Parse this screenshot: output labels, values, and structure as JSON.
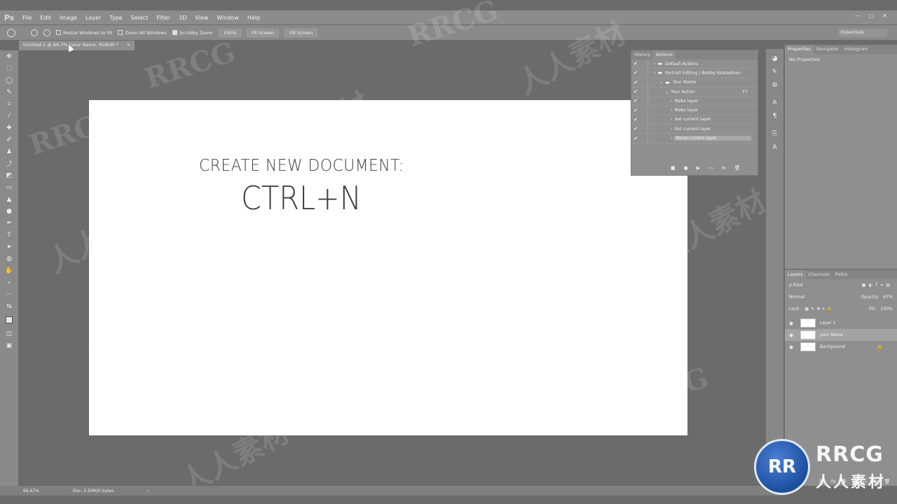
{
  "app": {
    "logo_text": "Ps",
    "menu": [
      "File",
      "Edit",
      "Image",
      "Layer",
      "Type",
      "Select",
      "Filter",
      "3D",
      "View",
      "Window",
      "Help"
    ],
    "window_controls": [
      "—",
      "▢",
      "✕"
    ]
  },
  "options_bar": {
    "resize_windows": "Resize Windows to Fit",
    "zoom_all": "Zoom All Windows",
    "scrubby_zoom": "Scrubby Zoom",
    "btn_100": "100%",
    "btn_fit": "Fit Screen",
    "btn_fill": "Fill Screen",
    "workspace": "Essentials"
  },
  "document": {
    "tab_title": "Untitled-1 @ 66,7% (your Name, RGB/8) *",
    "tab_close": "×",
    "headline": "CREATE NEW DOCUMENT:",
    "shortcut": "CTRL+N"
  },
  "actions_panel": {
    "tabs": [
      "History",
      "Actions"
    ],
    "rows": [
      {
        "label": "Default Actions",
        "indent": 0
      },
      {
        "label": "Portrait Editing | Bobby Kostadinov",
        "indent": 0
      },
      {
        "label": "Your Name",
        "indent": 1
      },
      {
        "label": "Your Action",
        "indent": 2,
        "fkey": "F7"
      },
      {
        "label": "Make layer",
        "indent": 3
      },
      {
        "label": "Make layer",
        "indent": 3
      },
      {
        "label": "Set current layer",
        "indent": 3
      },
      {
        "label": "Set current layer",
        "indent": 3
      },
      {
        "label": "Move current layer",
        "indent": 3,
        "selected": true
      }
    ],
    "footer_icons": [
      "■",
      "●",
      "▶",
      "▭",
      "⊕",
      "🗑"
    ]
  },
  "properties_panel": {
    "tabs": [
      "Properties",
      "Navigator",
      "Histogram"
    ],
    "content": "No Properties"
  },
  "layers_panel": {
    "tabs": [
      "Layers",
      "Channels",
      "Paths"
    ],
    "filter_label": "ρ Kind",
    "blend_mode": "Normal",
    "opacity_label": "Opacity:",
    "opacity_value": "67%",
    "lock_label": "Lock:",
    "fill_label": "Fill:",
    "fill_value": "100%",
    "layers": [
      {
        "name": "Layer 1",
        "selected": false,
        "locked": false
      },
      {
        "name": "your Name",
        "selected": true,
        "locked": false
      },
      {
        "name": "Background",
        "selected": false,
        "locked": true
      }
    ],
    "footer_icons": [
      "⛓",
      "fx",
      "◘",
      "◐",
      "▭",
      "⊕",
      "🗑"
    ]
  },
  "status_bar": {
    "zoom": "66.67%",
    "doc_info": "Doc: 5.93M/0 bytes",
    "arrow": "›"
  },
  "watermark": {
    "en": "RRCG",
    "cn": "人人素材"
  },
  "logo": {
    "circle": "RR",
    "en": "RRCG",
    "cn": "人人素材"
  }
}
